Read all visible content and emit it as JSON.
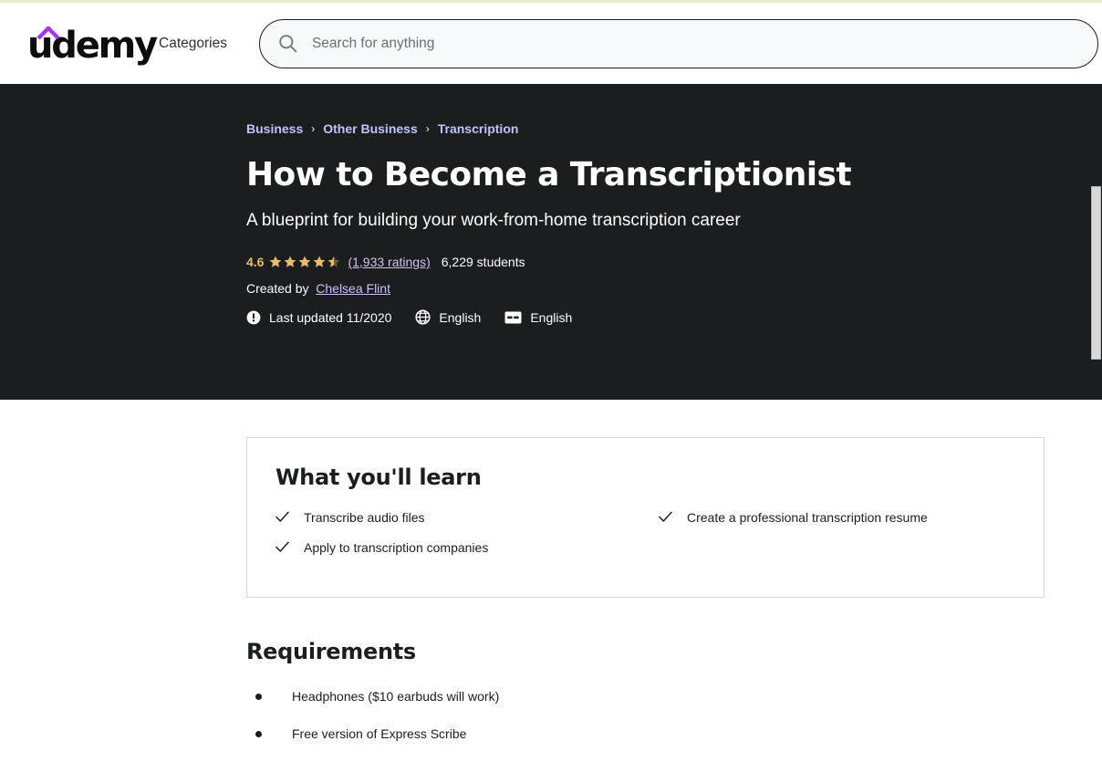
{
  "header": {
    "logo_text": "udemy",
    "logo_icon": "udemy-caret-icon",
    "logo_accent_color": "#a435f0",
    "categories_label": "Categories",
    "search": {
      "icon": "search-icon",
      "placeholder": "Search for anything",
      "value": ""
    }
  },
  "hero": {
    "background_color": "#1c1d1f",
    "breadcrumb": [
      {
        "label": "Business"
      },
      {
        "label": "Other Business"
      },
      {
        "label": "Transcription"
      }
    ],
    "breadcrumb_separator": "›",
    "title": "How to Become a Transcriptionist",
    "subtitle": "A blueprint for building your work-from-home transcription career",
    "rating": {
      "value": "4.6",
      "stars_filled": 4,
      "stars_half": 1,
      "stars_total": 5,
      "star_color": "#e8bd6d",
      "ratings_link": "(1,933 ratings)",
      "students": "6,229 students"
    },
    "creator": {
      "prefix": "Created by",
      "name": "Chelsea Flint"
    },
    "meta": [
      {
        "icon": "alert-circle-icon",
        "label": "Last updated 11/2020"
      },
      {
        "icon": "globe-icon",
        "label": "English"
      },
      {
        "icon": "closed-caption-icon",
        "label": "English"
      }
    ]
  },
  "what_you_will_learn": {
    "heading": "What you'll learn",
    "items": [
      "Transcribe audio files",
      "Create a professional transcription resume",
      "Apply to transcription companies"
    ]
  },
  "requirements": {
    "heading": "Requirements",
    "items": [
      "Headphones ($10 earbuds will work)",
      "Free version of Express Scribe"
    ]
  },
  "scrollbar": {
    "orientation": "vertical",
    "position": "right"
  }
}
